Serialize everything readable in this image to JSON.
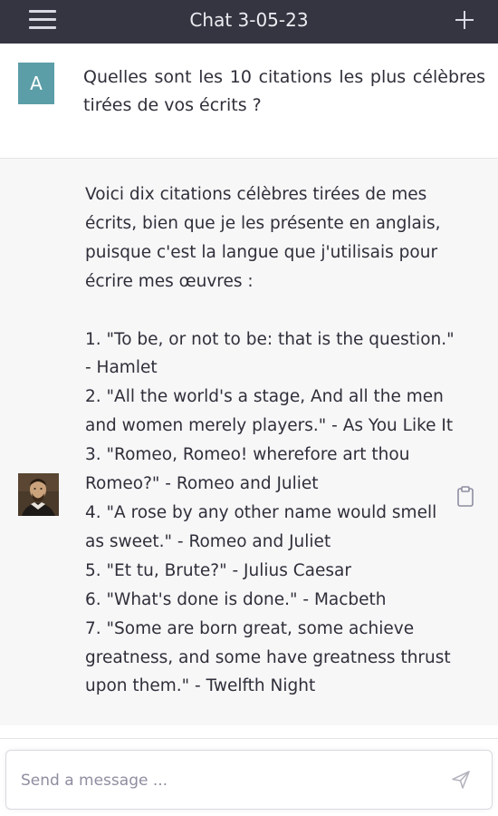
{
  "header": {
    "title": "Chat 3-05-23",
    "menu_icon": "hamburger-menu-icon",
    "new_chat_icon": "plus-icon"
  },
  "user_message": {
    "avatar_letter": "A",
    "avatar_color": "#5c9ea8",
    "text": "Quelles sont les 10 citations les plus célèbres tirées de vos écrits ?"
  },
  "assistant_message": {
    "avatar": "shakespeare-portrait",
    "text": "Voici dix citations célèbres tirées de mes écrits, bien que je les présente en anglais, puisque c'est la langue que j'utilisais pour écrire mes œuvres :\n\n1. \"To be, or not to be: that is the question.\" - Hamlet\n2. \"All the world's a stage, And all the men and women merely players.\" - As You Like It\n3. \"Romeo, Romeo! wherefore art thou Romeo?\" - Romeo and Juliet\n4. \"A rose by any other name would smell as sweet.\" - Romeo and Juliet\n5. \"Et tu, Brute?\" - Julius Caesar\n6. \"What's done is done.\" - Macbeth\n7. \"Some are born great, some achieve greatness, and some have greatness thrust upon them.\" - Twelfth Night",
    "copy_icon": "clipboard-icon"
  },
  "composer": {
    "placeholder": "Send a message ...",
    "value": "",
    "send_icon": "send-icon"
  },
  "colors": {
    "header_bg": "#343541",
    "assistant_bg": "#f7f7f8",
    "text": "#2f2f3a"
  }
}
